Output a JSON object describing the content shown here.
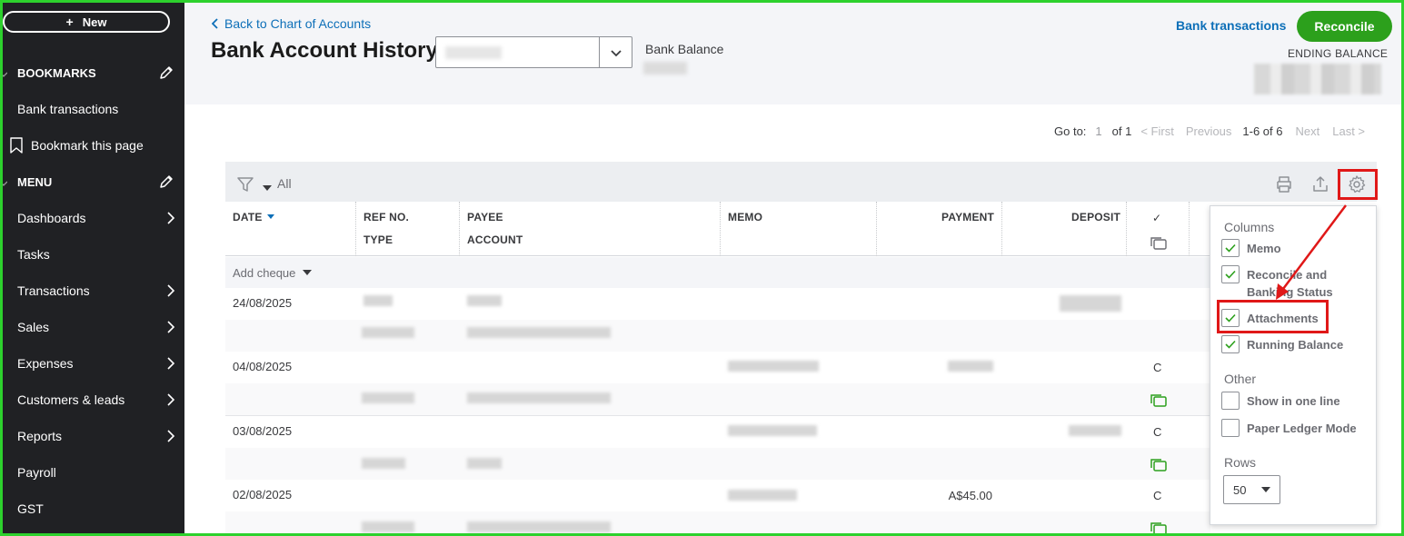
{
  "sidebar": {
    "new_label": "New",
    "bookmarks_heading": "BOOKMARKS",
    "bookmark_items": [
      "Bank transactions",
      "Bookmark this page"
    ],
    "menu_heading": "MENU",
    "menu_items": [
      {
        "label": "Dashboards",
        "has_chevron": true
      },
      {
        "label": "Tasks",
        "has_chevron": false
      },
      {
        "label": "Transactions",
        "has_chevron": true
      },
      {
        "label": "Sales",
        "has_chevron": true
      },
      {
        "label": "Expenses",
        "has_chevron": true
      },
      {
        "label": "Customers & leads",
        "has_chevron": true
      },
      {
        "label": "Reports",
        "has_chevron": true
      },
      {
        "label": "Payroll",
        "has_chevron": false
      },
      {
        "label": "GST",
        "has_chevron": false
      }
    ]
  },
  "header": {
    "back_link": "Back to Chart of Accounts",
    "title": "Bank Account History",
    "bank_balance_label": "Bank Balance",
    "bank_transactions_link": "Bank transactions",
    "reconcile_label": "Reconcile",
    "ending_balance_label": "ENDING BALANCE"
  },
  "pagination": {
    "goto_label": "Go to:",
    "page_value": "1",
    "of_label": "of 1",
    "first": "< First",
    "previous": "Previous",
    "range": "1-6 of 6",
    "next": "Next",
    "last": "Last >"
  },
  "toolbar": {
    "filter_value": "All"
  },
  "table": {
    "headers": {
      "date": "DATE",
      "ref_no": "REF NO.",
      "type": "TYPE",
      "payee": "PAYEE",
      "account": "ACCOUNT",
      "memo": "MEMO",
      "payment": "PAYMENT",
      "deposit": "DEPOSIT",
      "reconcile_status": "✓"
    },
    "add_row_label": "Add cheque",
    "rows": [
      {
        "date": "24/08/2025",
        "payment": "",
        "status": ""
      },
      {
        "date": "04/08/2025",
        "payment": "",
        "status": "C"
      },
      {
        "date": "03/08/2025",
        "payment": "",
        "status": "C"
      },
      {
        "date": "02/08/2025",
        "payment": "A$45.00",
        "status": "C"
      }
    ]
  },
  "settings_panel": {
    "columns_heading": "Columns",
    "columns": [
      {
        "label": "Memo",
        "checked": true
      },
      {
        "label": "Reconcile and Banking Status",
        "checked": true
      },
      {
        "label": "Attachments",
        "checked": true
      },
      {
        "label": "Running Balance",
        "checked": true
      }
    ],
    "other_heading": "Other",
    "other": [
      {
        "label": "Show in one line",
        "checked": false
      },
      {
        "label": "Paper Ledger Mode",
        "checked": false
      }
    ],
    "rows_heading": "Rows",
    "rows_value": "50"
  },
  "colors": {
    "sidebar_bg": "#202124",
    "link_blue": "#0d6fb8",
    "reconcile_green": "#2ca01c",
    "highlight_red": "#e01818",
    "frame_green": "#2dd12d",
    "attachment_green": "#2ca01c"
  }
}
